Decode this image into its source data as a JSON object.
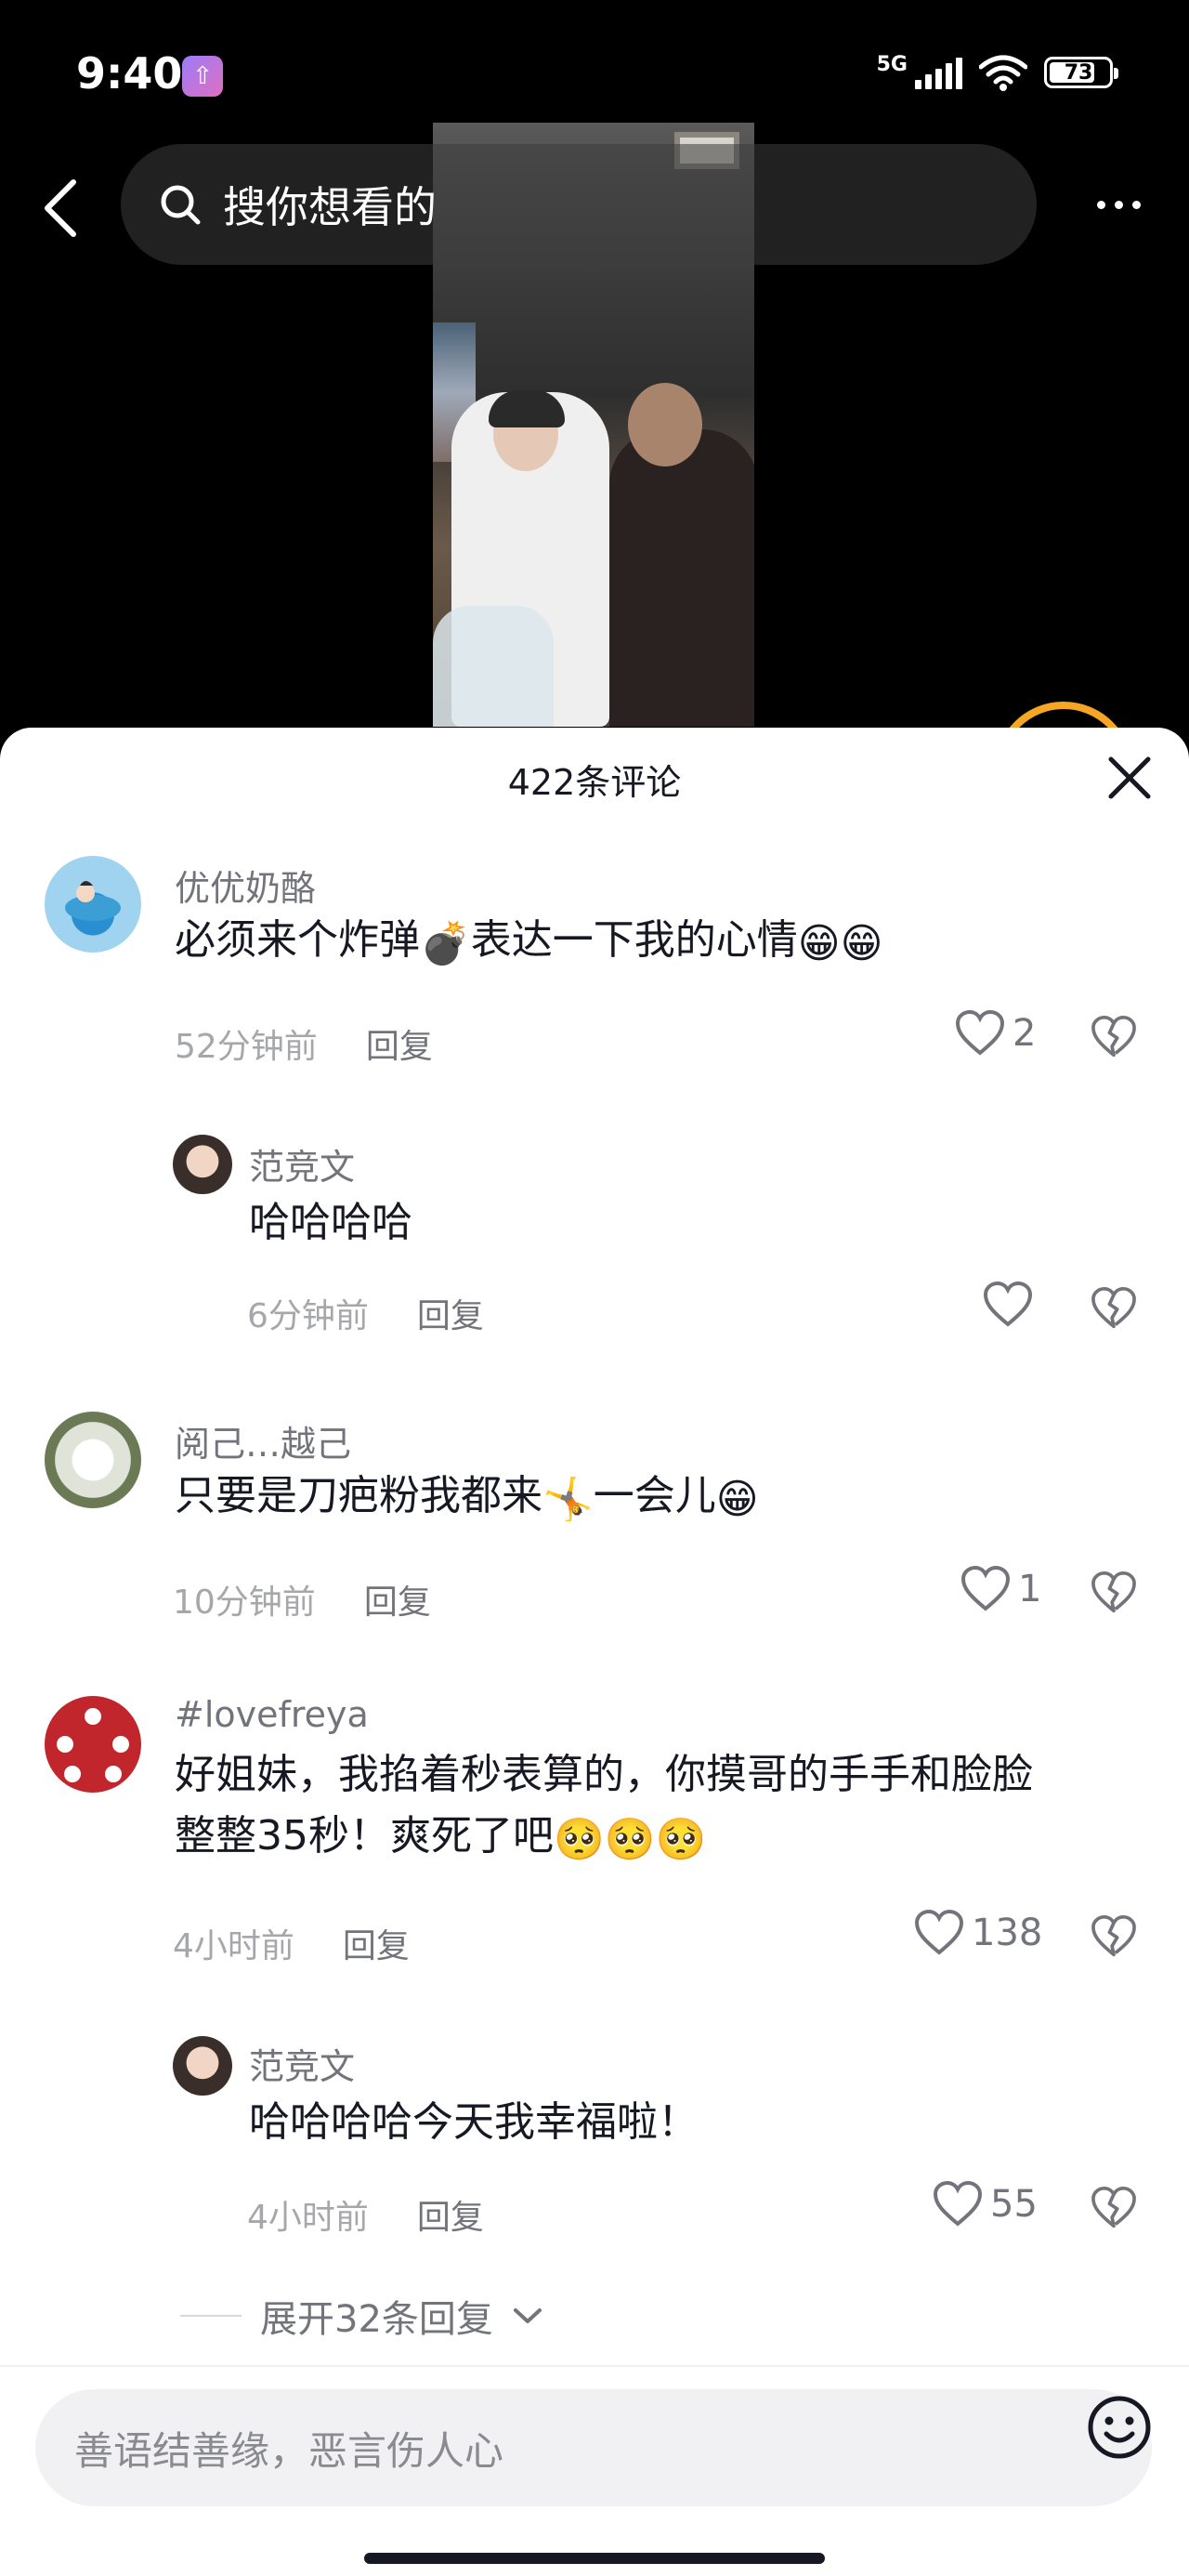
{
  "status_bar": {
    "time": "9:40",
    "network": "5G",
    "battery": "73"
  },
  "nav": {
    "search_placeholder": "搜你想看的"
  },
  "comments_sheet": {
    "title": "422条评论",
    "comments": [
      {
        "username": "优优奶酪",
        "text": "必须来个炸弹",
        "text2": "表达一下我的心情",
        "emoji1": "💣",
        "emoji2": "😁😁",
        "time": "52分钟前",
        "reply": "回复",
        "likes": "2"
      },
      {
        "username": "范竞文",
        "text": "哈哈哈哈",
        "time": "6分钟前",
        "reply": "回复",
        "likes": ""
      },
      {
        "username": "阅己…越己",
        "text": "只要是刀疤粉我都来",
        "emoji1": "🤸",
        "text2": "一会儿",
        "emoji2": "😁",
        "time": "10分钟前",
        "reply": "回复",
        "likes": "1"
      },
      {
        "username": "#lovefreya",
        "text": "好姐妹，我掐着秒表算的，你摸哥的手手和脸脸",
        "text_line2": "整整35秒！爽死了吧",
        "emoji2": "🥺🥺🥺",
        "time": "4小时前",
        "reply": "回复",
        "likes": "138"
      },
      {
        "username": "范竞文",
        "text": "哈哈哈哈今天我幸福啦！",
        "time": "4小时前",
        "reply": "回复",
        "likes": "55"
      }
    ],
    "expand_replies": "展开32条回复"
  },
  "input": {
    "placeholder": "善语结善缘，恶言伤人心"
  },
  "icons": {
    "back": "back-arrow-icon",
    "search": "search-icon",
    "more": "more-icon",
    "close": "close-icon",
    "like": "heart-icon",
    "dislike": "broken-heart-icon",
    "emoji": "smiley-icon"
  }
}
